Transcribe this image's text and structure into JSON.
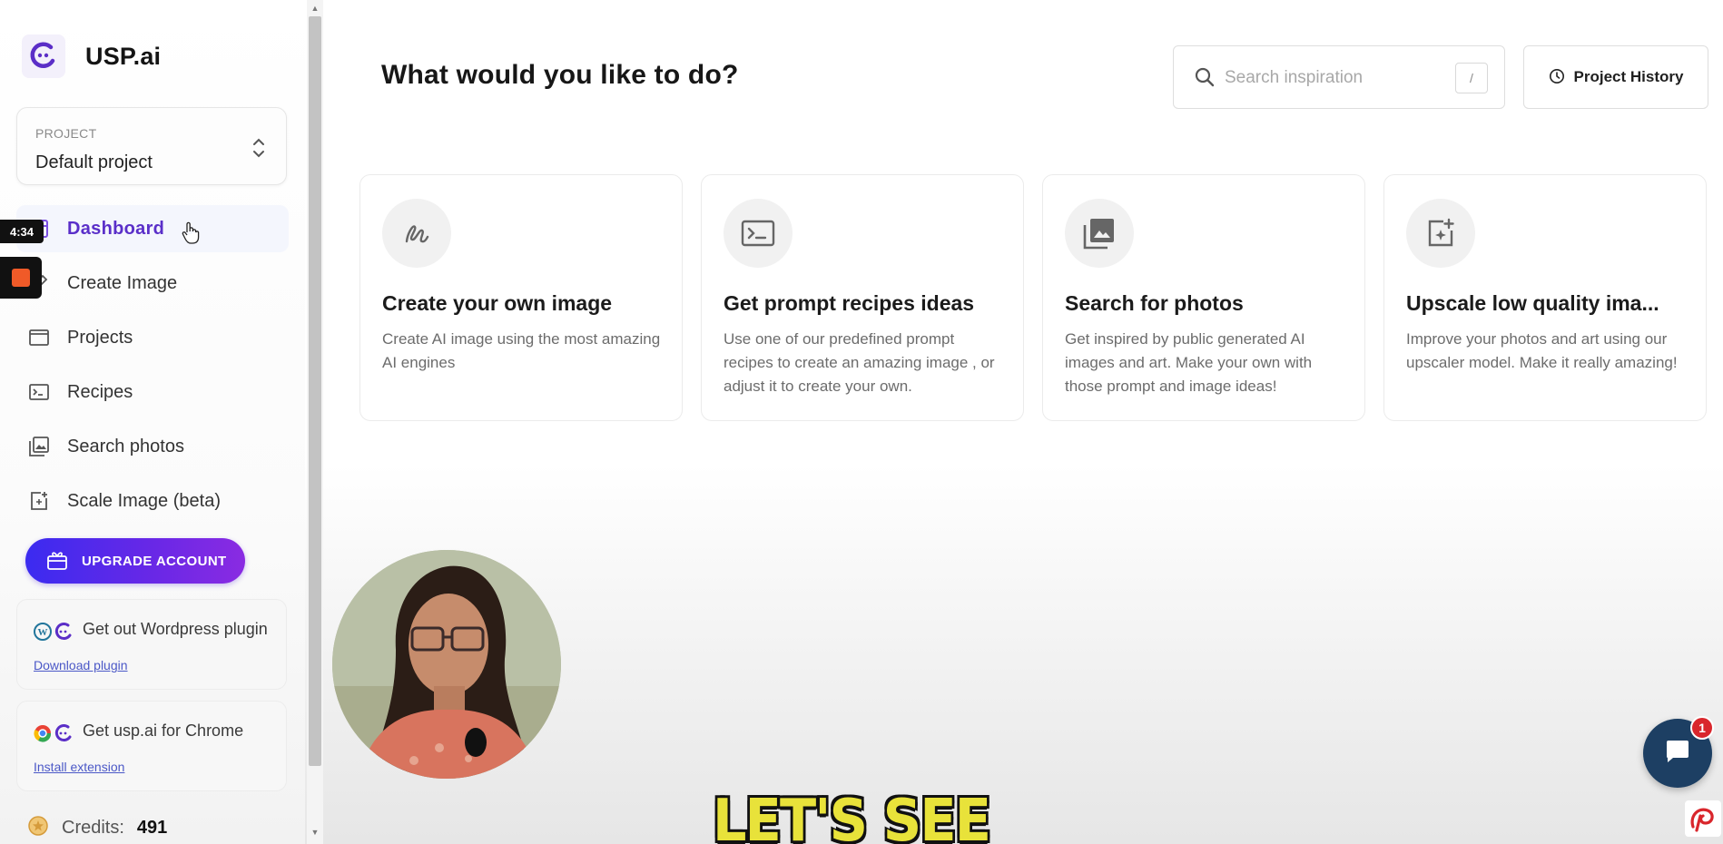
{
  "brand": {
    "name": "USP.ai",
    "logo_icon": "usp-logo-icon",
    "accent": "#5a2fc9"
  },
  "project": {
    "label": "PROJECT",
    "value": "Default project"
  },
  "nav": {
    "items": [
      {
        "label": "Dashboard",
        "icon": "dashboard-icon",
        "active": true
      },
      {
        "label": "Create Image",
        "icon": "pencil-icon"
      },
      {
        "label": "Projects",
        "icon": "window-icon"
      },
      {
        "label": "Recipes",
        "icon": "terminal-icon"
      },
      {
        "label": "Search photos",
        "icon": "photos-icon"
      },
      {
        "label": "Scale Image (beta)",
        "icon": "image-plus-icon"
      }
    ]
  },
  "upgrade": {
    "label": "UPGRADE ACCOUNT",
    "icon": "gift-icon"
  },
  "promos": [
    {
      "title": "Get out Wordpress plugin",
      "link": "Download plugin",
      "icon": "wordpress-icon"
    },
    {
      "title": "Get usp.ai for Chrome",
      "link": "Install extension",
      "icon": "chrome-icon"
    }
  ],
  "credits": {
    "label": "Credits:",
    "value": "491"
  },
  "overlay": {
    "time": "4:34",
    "caption": "LET'S SEE",
    "chat_badge": "1"
  },
  "header": {
    "title": "What would you like to do?",
    "search_placeholder": "Search inspiration",
    "search_shortcut": "/",
    "history_label": "Project History"
  },
  "cards": [
    {
      "title": "Create your own image",
      "desc": "Create AI image using the most amazing AI engines",
      "icon": "scribble-icon"
    },
    {
      "title": "Get prompt recipes ideas",
      "desc": "Use one of our predefined prompt recipes to create an amazing image , or adjust it to create your own.",
      "icon": "terminal-icon"
    },
    {
      "title": "Search for photos",
      "desc": "Get inspired by public generated AI images and art. Make your own with those prompt and image ideas!",
      "icon": "photos-icon"
    },
    {
      "title": "Upscale low quality ima...",
      "desc": "Improve your photos and art using our upscaler model. Make it really amazing!",
      "icon": "image-plus-icon"
    }
  ]
}
